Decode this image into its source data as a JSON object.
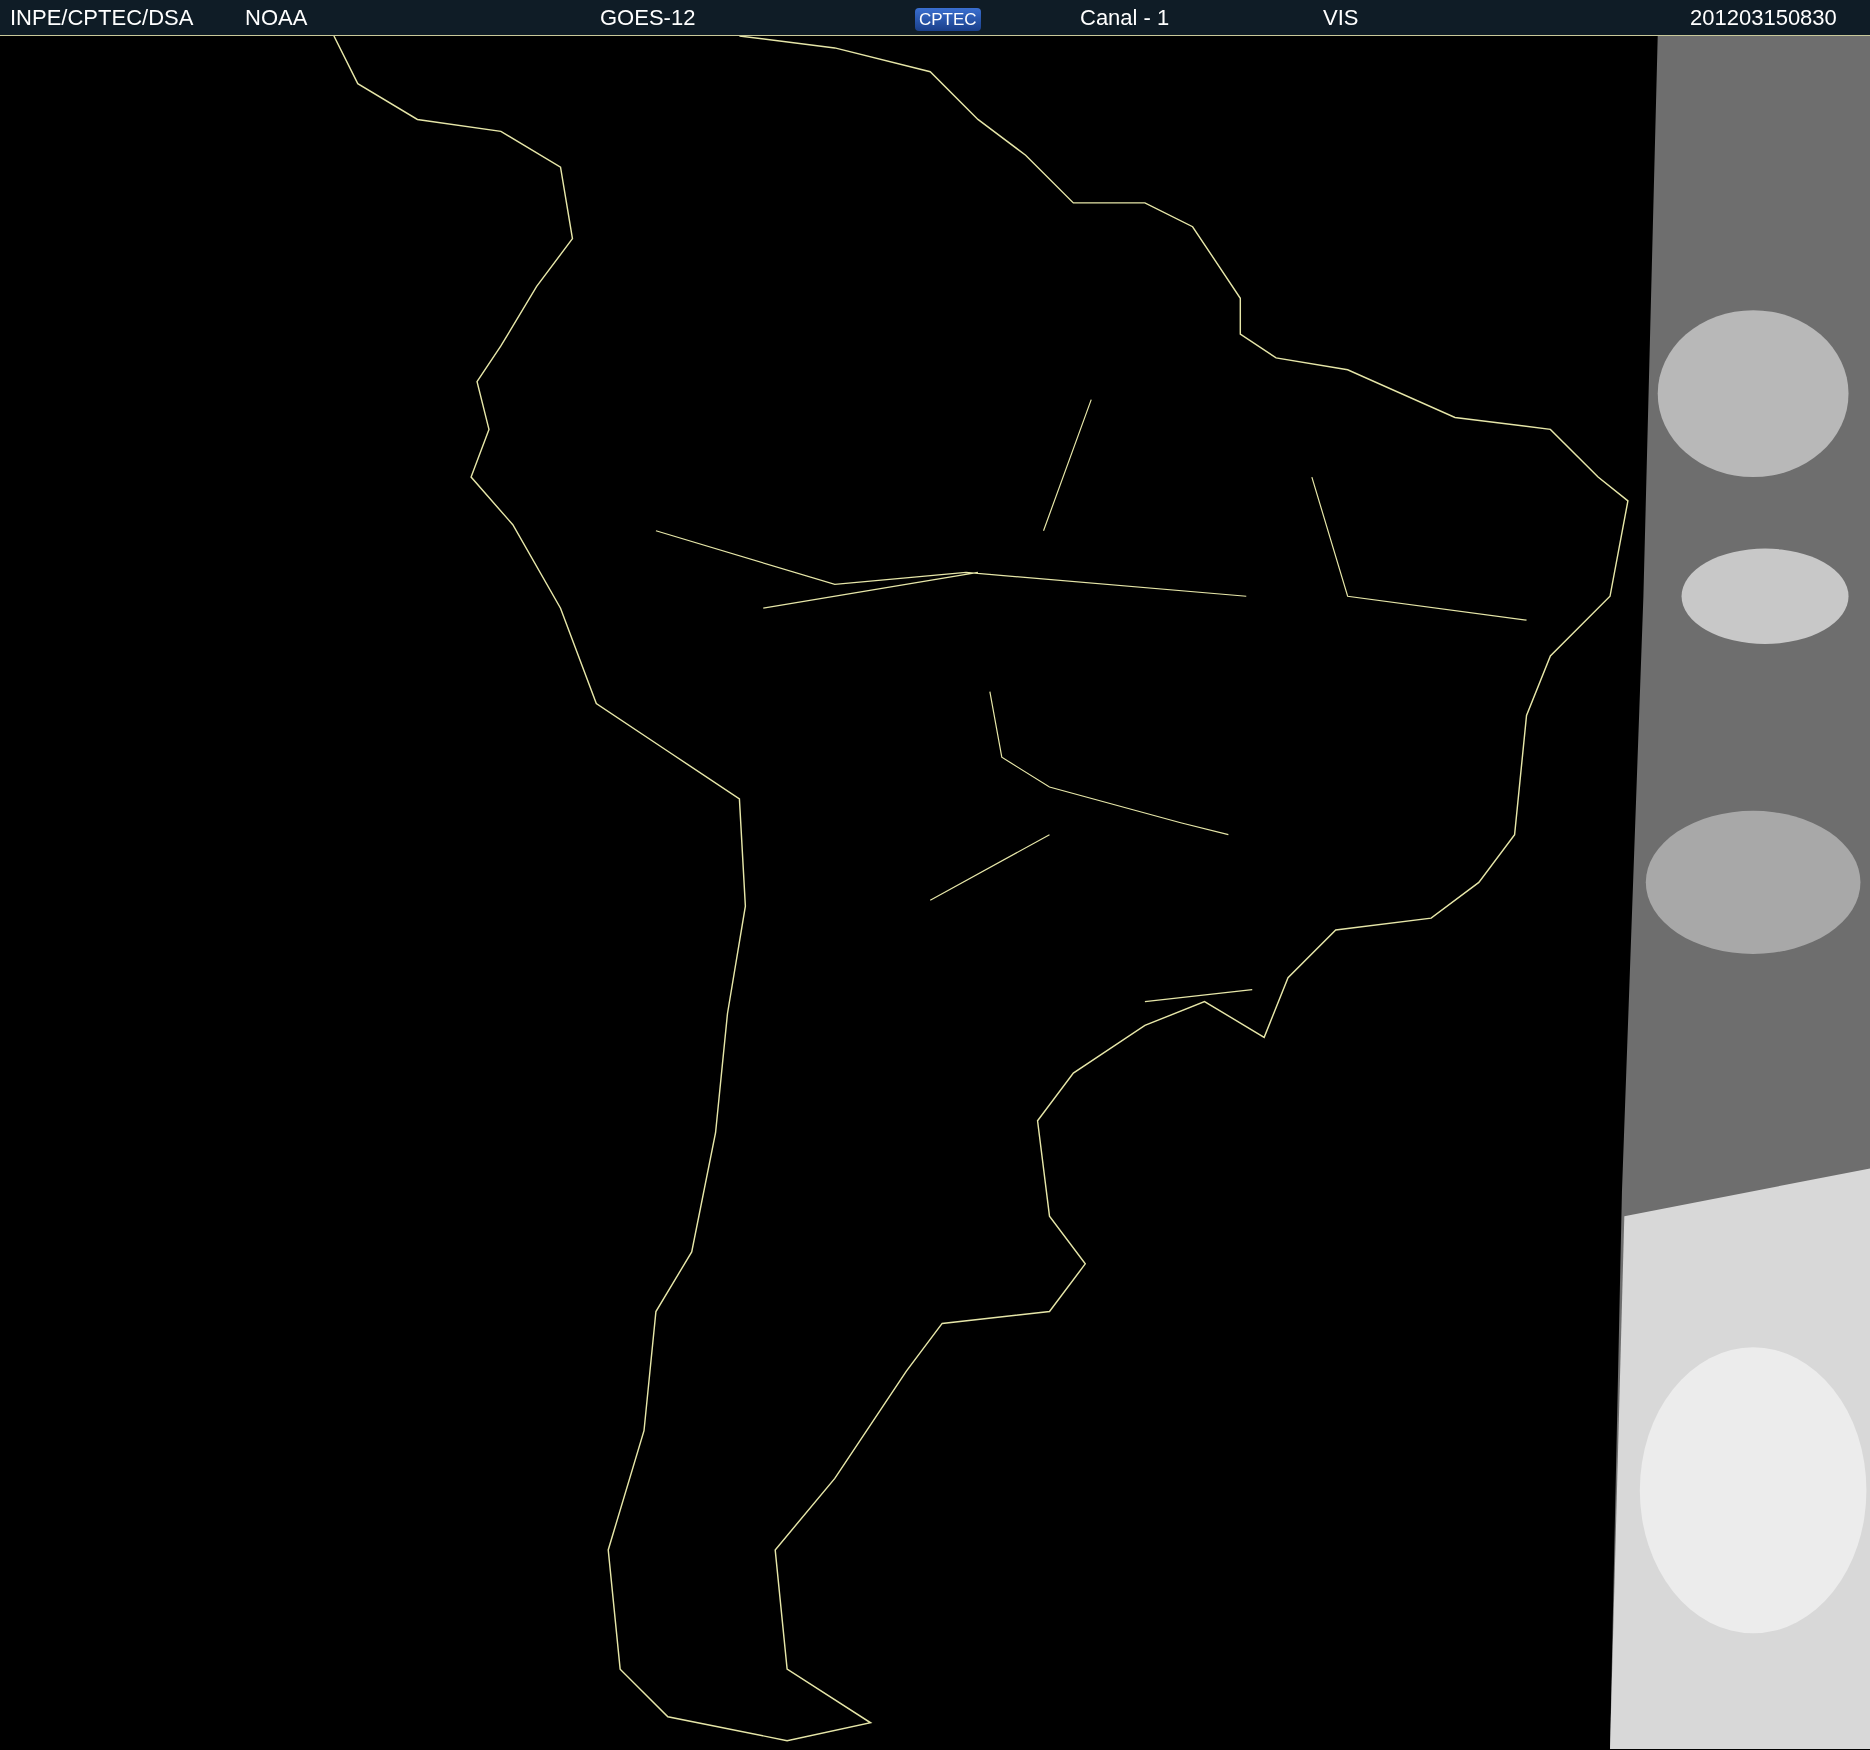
{
  "header": {
    "items": [
      {
        "kind": "text",
        "text": "INPE/CPTEC/DSA"
      },
      {
        "kind": "text",
        "text": "NOAA"
      },
      {
        "kind": "text",
        "text": "GOES-12"
      },
      {
        "kind": "logo",
        "text": "CPTEC"
      },
      {
        "kind": "text",
        "text": "Canal - 1"
      },
      {
        "kind": "text",
        "text": "VIS"
      },
      {
        "kind": "text",
        "text": "201203150830"
      }
    ]
  }
}
